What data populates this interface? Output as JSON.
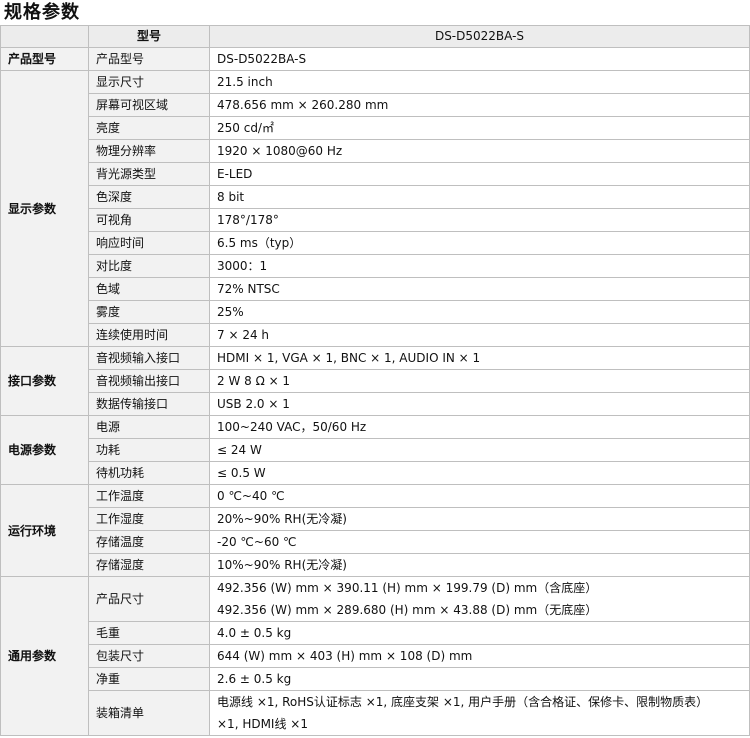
{
  "title": "规格参数",
  "header": {
    "label": "型号",
    "model": "DS-D5022BA-S"
  },
  "sections": [
    {
      "name": "产品型号",
      "rows": [
        {
          "label": "产品型号",
          "value": [
            "DS-D5022BA-S"
          ]
        }
      ]
    },
    {
      "name": "显示参数",
      "rows": [
        {
          "label": "显示尺寸",
          "value": [
            "21.5 inch"
          ]
        },
        {
          "label": "屏幕可视区域",
          "value": [
            "478.656 mm × 260.280 mm"
          ]
        },
        {
          "label": "亮度",
          "value": [
            "250 cd/㎡"
          ]
        },
        {
          "label": "物理分辨率",
          "value": [
            "1920 × 1080@60 Hz"
          ]
        },
        {
          "label": "背光源类型",
          "value": [
            "E-LED"
          ]
        },
        {
          "label": "色深度",
          "value": [
            "8 bit"
          ]
        },
        {
          "label": "可视角",
          "value": [
            "178°/178°"
          ]
        },
        {
          "label": "响应时间",
          "value": [
            "6.5 ms（typ）"
          ]
        },
        {
          "label": "对比度",
          "value": [
            "3000：1"
          ]
        },
        {
          "label": "色域",
          "value": [
            "72% NTSC"
          ]
        },
        {
          "label": "雾度",
          "value": [
            "25%"
          ]
        },
        {
          "label": "连续使用时间",
          "value": [
            "7 × 24 h"
          ]
        }
      ]
    },
    {
      "name": "接口参数",
      "rows": [
        {
          "label": "音视频输入接口",
          "value": [
            "HDMI × 1, VGA × 1, BNC × 1, AUDIO IN × 1"
          ]
        },
        {
          "label": "音视频输出接口",
          "value": [
            "2 W 8 Ω  × 1"
          ]
        },
        {
          "label": "数据传输接口",
          "value": [
            "USB 2.0 × 1"
          ]
        }
      ]
    },
    {
      "name": "电源参数",
      "rows": [
        {
          "label": "电源",
          "value": [
            "100~240 VAC，50/60 Hz"
          ]
        },
        {
          "label": "功耗",
          "value": [
            "≤ 24 W"
          ]
        },
        {
          "label": "待机功耗",
          "value": [
            "≤ 0.5 W"
          ]
        }
      ]
    },
    {
      "name": "运行环境",
      "rows": [
        {
          "label": "工作温度",
          "value": [
            "0 ℃~40 ℃"
          ]
        },
        {
          "label": "工作湿度",
          "value": [
            "20%~90% RH(无冷凝)"
          ]
        },
        {
          "label": "存储温度",
          "value": [
            "-20 ℃~60 ℃"
          ]
        },
        {
          "label": "存储湿度",
          "value": [
            "10%~90% RH(无冷凝)"
          ]
        }
      ]
    },
    {
      "name": "通用参数",
      "rows": [
        {
          "label": "产品尺寸",
          "value": [
            "492.356 (W) mm × 390.11 (H) mm × 199.79 (D) mm（含底座）",
            "492.356 (W) mm × 289.680 (H) mm × 43.88 (D) mm（无底座）"
          ]
        },
        {
          "label": "毛重",
          "value": [
            "4.0 ± 0.5 kg"
          ]
        },
        {
          "label": "包装尺寸",
          "value": [
            "644 (W) mm × 403 (H) mm × 108 (D) mm"
          ]
        },
        {
          "label": "净重",
          "value": [
            "2.6 ± 0.5 kg"
          ]
        },
        {
          "label": "装箱清单",
          "value": [
            "电源线 ×1, RoHS认证标志 ×1,  底座支架 ×1,  用户手册（含合格证、保修卡、限制物质表）",
            "×1, HDMI线 ×1"
          ]
        }
      ]
    }
  ]
}
